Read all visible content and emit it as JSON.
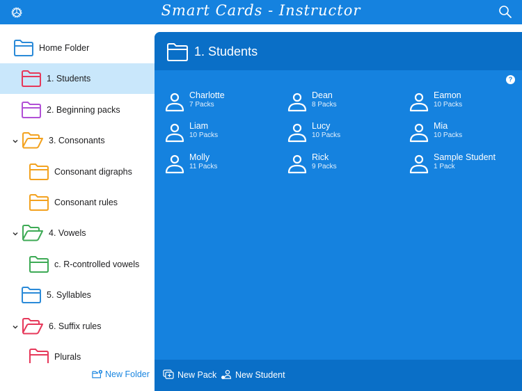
{
  "app": {
    "title": "Smart Cards - Instructor",
    "settings_icon": "gear-icon",
    "search_icon": "search-icon"
  },
  "sidebar": {
    "items": [
      {
        "label": "Home Folder",
        "color": "#2a8ad8",
        "level": 0,
        "expandable": false,
        "open": false,
        "selected": false
      },
      {
        "label": "1. Students",
        "color": "#e6385a",
        "level": 1,
        "expandable": false,
        "open": false,
        "selected": true
      },
      {
        "label": "2. Beginning packs",
        "color": "#b150d6",
        "level": 1,
        "expandable": false,
        "open": false,
        "selected": false
      },
      {
        "label": "3. Consonants",
        "color": "#f3a21f",
        "level": 1,
        "expandable": true,
        "open": true,
        "selected": false
      },
      {
        "label": "Consonant digraphs",
        "color": "#f3a21f",
        "level": 2,
        "expandable": false,
        "open": false,
        "selected": false
      },
      {
        "label": "Consonant rules",
        "color": "#f3a21f",
        "level": 2,
        "expandable": false,
        "open": false,
        "selected": false
      },
      {
        "label": "4. Vowels",
        "color": "#3daa55",
        "level": 1,
        "expandable": true,
        "open": true,
        "selected": false
      },
      {
        "label": "c. R-controlled vowels",
        "color": "#3daa55",
        "level": 2,
        "expandable": false,
        "open": false,
        "selected": false
      },
      {
        "label": "5. Syllables",
        "color": "#2a8ad8",
        "level": 1,
        "expandable": false,
        "open": false,
        "selected": false
      },
      {
        "label": "6. Suffix rules",
        "color": "#e6385a",
        "level": 1,
        "expandable": true,
        "open": true,
        "selected": false
      },
      {
        "label": "Plurals",
        "color": "#e6385a",
        "level": 2,
        "expandable": false,
        "open": false,
        "selected": false
      }
    ],
    "new_folder_label": "New Folder"
  },
  "main": {
    "title": "1. Students",
    "help_label": "?",
    "students": [
      {
        "name": "Charlotte",
        "packs": "7 Packs"
      },
      {
        "name": "Dean",
        "packs": "8 Packs"
      },
      {
        "name": "Eamon",
        "packs": "10 Packs"
      },
      {
        "name": "Liam",
        "packs": "10 Packs"
      },
      {
        "name": "Lucy",
        "packs": "10 Packs"
      },
      {
        "name": "Mia",
        "packs": "10 Packs"
      },
      {
        "name": "Molly",
        "packs": "11 Packs"
      },
      {
        "name": "Rick",
        "packs": "9 Packs"
      },
      {
        "name": "Sample Student",
        "packs": "1 Pack"
      }
    ],
    "footer": {
      "new_pack_label": "New Pack",
      "new_student_label": "New Student"
    }
  },
  "colors": {
    "topbar": "#1582df",
    "panel": "#1582df",
    "panel_header": "#0a6fc7",
    "selected_row": "#c9e7fb",
    "link": "#1a86e0"
  }
}
